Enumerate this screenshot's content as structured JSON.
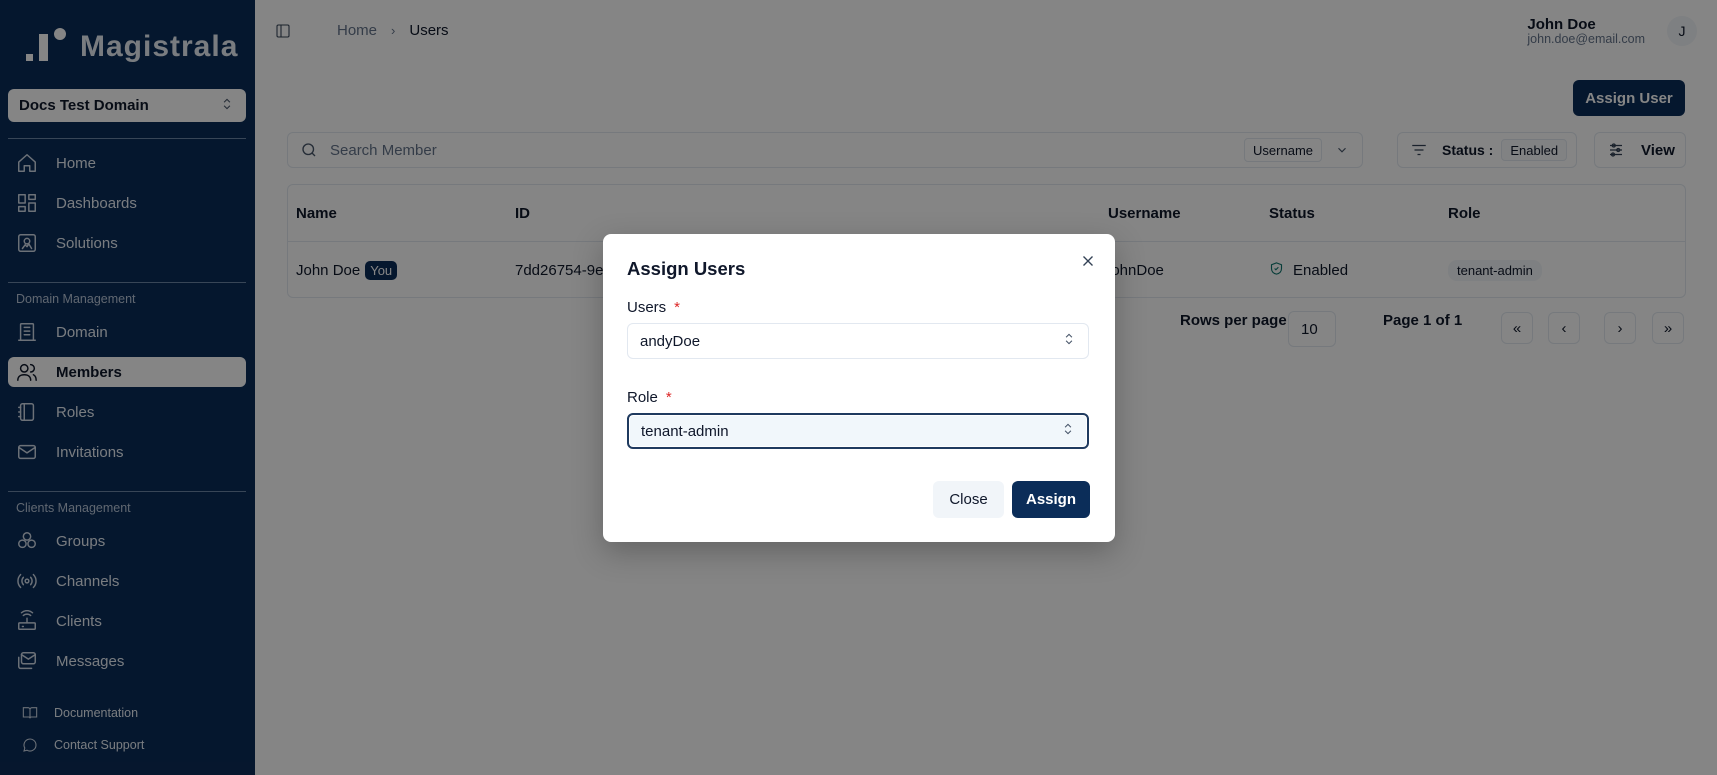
{
  "brand": {
    "name": "Magistrala"
  },
  "sidebar": {
    "domain_select": "Docs Test Domain",
    "main_items": [
      {
        "label": "Home",
        "icon": "home-icon"
      },
      {
        "label": "Dashboards",
        "icon": "dashboard-icon"
      },
      {
        "label": "Solutions",
        "icon": "solutions-icon"
      }
    ],
    "domain_section_label": "Domain Management",
    "domain_items": [
      {
        "label": "Domain",
        "icon": "domain-icon"
      },
      {
        "label": "Members",
        "icon": "users-icon"
      },
      {
        "label": "Roles",
        "icon": "roles-icon"
      },
      {
        "label": "Invitations",
        "icon": "mail-icon"
      }
    ],
    "clients_section_label": "Clients Management",
    "clients_items": [
      {
        "label": "Groups",
        "icon": "groups-icon"
      },
      {
        "label": "Channels",
        "icon": "channels-icon"
      },
      {
        "label": "Clients",
        "icon": "clients-icon"
      },
      {
        "label": "Messages",
        "icon": "messages-icon"
      }
    ],
    "footer_items": [
      {
        "label": "Documentation",
        "icon": "book-icon"
      },
      {
        "label": "Contact Support",
        "icon": "chat-icon"
      }
    ]
  },
  "header": {
    "breadcrumb": [
      "Home",
      "Users"
    ],
    "user_name": "John Doe",
    "user_email": "john.doe@email.com",
    "avatar_initial": "J"
  },
  "toolbar": {
    "assign_user_label": "Assign User",
    "search_placeholder": "Search Member",
    "search_field": "Username",
    "status_label": "Status :",
    "status_value": "Enabled",
    "view_label": "View"
  },
  "table": {
    "columns": [
      "Name",
      "ID",
      "Username",
      "Status",
      "Role"
    ],
    "rows": [
      {
        "name": "John Doe",
        "you_badge": "You",
        "id": "7dd26754-9e",
        "username": "johnDoe",
        "status": "Enabled",
        "role": "tenant-admin"
      }
    ]
  },
  "pagination": {
    "rows_per_page_label": "Rows per page",
    "rows_per_page": "10",
    "page_label": "Page 1 of 1",
    "first": "«",
    "prev": "‹",
    "next": "›",
    "last": "»"
  },
  "modal": {
    "title": "Assign Users",
    "users_label": "Users",
    "users_value": "andyDoe",
    "role_label": "Role",
    "role_value": "tenant-admin",
    "required_mark": "*",
    "close_label": "Close",
    "assign_label": "Assign"
  },
  "colors": {
    "sidebar_bg": "#0b2d59",
    "primary": "#0b2d59",
    "required": "#dc2626"
  }
}
